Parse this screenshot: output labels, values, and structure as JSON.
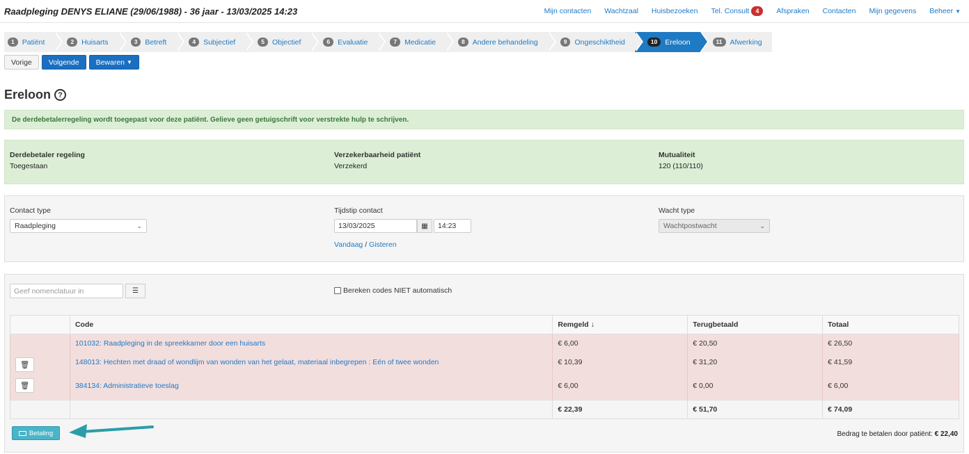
{
  "header": {
    "title": "Raadpleging DENYS ELIANE (29/06/1988) - 36 jaar - 13/03/2025 14:23",
    "nav": [
      {
        "label": "Mijn contacten"
      },
      {
        "label": "Wachtzaal"
      },
      {
        "label": "Huisbezoeken"
      },
      {
        "label": "Tel. Consult",
        "badge": "4"
      },
      {
        "label": "Afspraken"
      },
      {
        "label": "Contacten"
      },
      {
        "label": "Mijn gegevens"
      },
      {
        "label": "Beheer"
      }
    ]
  },
  "steps": [
    {
      "num": "1",
      "label": "Patiënt"
    },
    {
      "num": "2",
      "label": "Huisarts"
    },
    {
      "num": "3",
      "label": "Betreft"
    },
    {
      "num": "4",
      "label": "Subjectief"
    },
    {
      "num": "5",
      "label": "Objectief"
    },
    {
      "num": "6",
      "label": "Evaluatie"
    },
    {
      "num": "7",
      "label": "Medicatie"
    },
    {
      "num": "8",
      "label": "Andere behandeling"
    },
    {
      "num": "9",
      "label": "Ongeschiktheid"
    },
    {
      "num": "10",
      "label": "Ereloon",
      "active": true
    },
    {
      "num": "11",
      "label": "Afwerking"
    }
  ],
  "buttons": {
    "prev": "Vorige",
    "next": "Volgende",
    "save": "Bewaren"
  },
  "page_title": "Ereloon",
  "alert": "De derdebetalerregeling wordt toegepast voor deze patiënt. Gelieve geen getuigschrift voor verstrekte hulp te schrijven.",
  "info": {
    "derdebetaler_label": "Derdebetaler regeling",
    "derdebetaler_value": "Toegestaan",
    "verzekerbaarheid_label": "Verzekerbaarheid patiënt",
    "verzekerbaarheid_value": "Verzekerd",
    "mutualiteit_label": "Mutualiteit",
    "mutualiteit_value": "120 (110/110)"
  },
  "contact": {
    "type_label": "Contact type",
    "type_value": "Raadpleging",
    "tijdstip_label": "Tijdstip contact",
    "date_value": "13/03/2025",
    "time_value": "14:23",
    "vandaag": "Vandaag",
    "sep": "/",
    "gisteren": "Gisteren",
    "wacht_label": "Wacht type",
    "wacht_value": "Wachtpostwacht"
  },
  "codes": {
    "search_placeholder": "Geef nomenclatuur in",
    "auto_checkbox_label": "Bereken codes NIET automatisch",
    "columns": {
      "code": "Code",
      "remgeld": "Remgeld ↓",
      "terugbetaald": "Terugbetaald",
      "totaal": "Totaal"
    },
    "rows": [
      {
        "code": "101032: Raadpleging in de spreekkamer door een huisarts",
        "remgeld": "€ 6,00",
        "terugbetaald": "€ 20,50",
        "totaal": "€ 26,50"
      },
      {
        "code": "148013: Hechten met draad of wondlijm van wonden van het gelaat, materiaal inbegrepen : Eén of twee wonden",
        "remgeld": "€ 10,39",
        "terugbetaald": "€ 31,20",
        "totaal": "€ 41,59"
      },
      {
        "code": "384134: Administratieve toeslag",
        "remgeld": "€ 6,00",
        "terugbetaald": "€ 0,00",
        "totaal": "€ 6,00"
      }
    ],
    "totals": {
      "remgeld": "€ 22,39",
      "terugbetaald": "€ 51,70",
      "totaal": "€ 74,09"
    },
    "pay_button": "Betaling",
    "pay_text": "Bedrag te betalen door patiënt:",
    "pay_amount": "€ 22,40"
  },
  "colors": {
    "accent": "#1a6fc0",
    "success_bg": "#dcefd6",
    "error_row": "#f3dede",
    "arrow": "#2a9ea8"
  }
}
